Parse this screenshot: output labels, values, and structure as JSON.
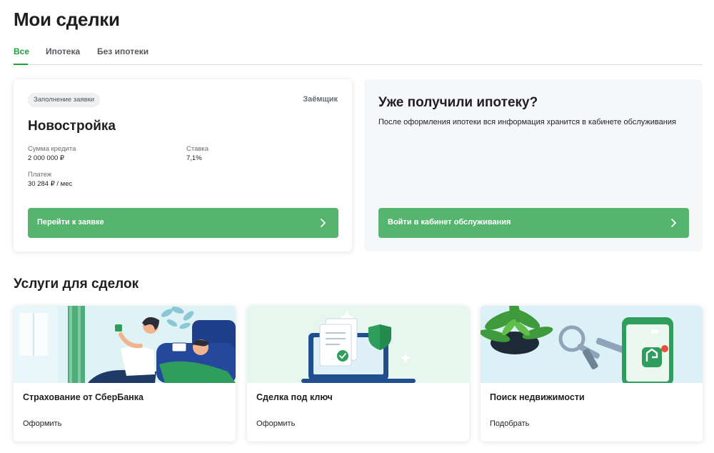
{
  "header": {
    "title": "Мои сделки"
  },
  "tabs": [
    {
      "label": "Все",
      "active": true
    },
    {
      "label": "Ипотека",
      "active": false
    },
    {
      "label": "Без ипотеки",
      "active": false
    }
  ],
  "deal": {
    "status": "Заполнение заявки",
    "role": "Заёмщик",
    "title": "Новостройка",
    "fields": {
      "amount_label": "Сумма кредита",
      "amount_value": "2 000 000 ₽",
      "rate_label": "Ставка",
      "rate_value": "7,1%",
      "payment_label": "Платеж",
      "payment_value": "30 284 ₽ / мес"
    },
    "button_label": "Перейти к заявке"
  },
  "info": {
    "title": "Уже получили ипотеку?",
    "text": "После оформления ипотеки вся информация хранится в кабинете обслуживания",
    "button_label": "Войти в кабинет обслуживания"
  },
  "services": {
    "title": "Услуги для сделок",
    "items": [
      {
        "title": "Страхование от СберБанка",
        "action": "Оформить",
        "image": "insurance-illustration"
      },
      {
        "title": "Сделка под ключ",
        "action": "Оформить",
        "image": "turnkey-deal-illustration"
      },
      {
        "title": "Поиск недвижимости",
        "action": "Подобрать",
        "image": "property-search-illustration"
      }
    ]
  },
  "colors": {
    "accent": "#21a038",
    "button": "#55b46d",
    "info_bg": "#f6f7f9"
  }
}
